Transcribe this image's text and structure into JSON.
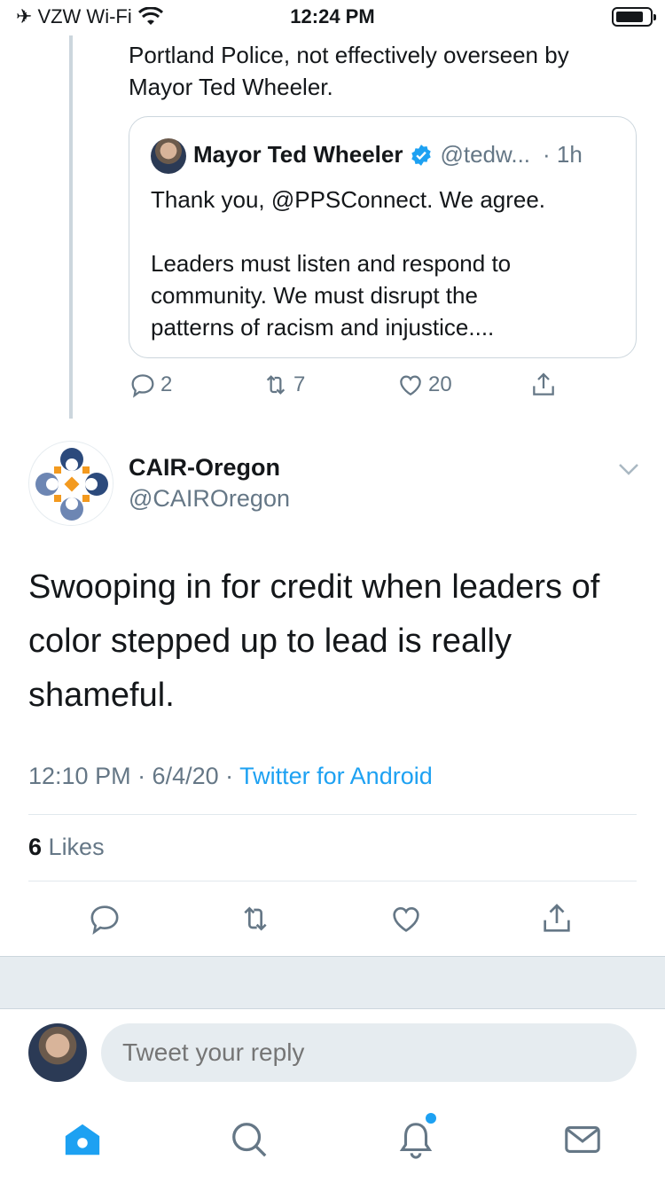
{
  "status_bar": {
    "carrier": "VZW Wi-Fi",
    "time": "12:24 PM"
  },
  "parent_tweet": {
    "text_line1": "Portland Police, not effectively overseen by",
    "text_line2": "Mayor Ted Wheeler.",
    "quoted": {
      "name": "Mayor Ted Wheeler",
      "handle": "@tedw...",
      "age": "· 1h",
      "line1": "Thank you, @PPSConnect. We agree.",
      "line2": "Leaders must listen and respond to",
      "line3": "community. We must disrupt the",
      "line4": "patterns of racism and injustice...."
    },
    "reply_count": "2",
    "retweet_count": "7",
    "like_count": "20"
  },
  "main_tweet": {
    "author_name": "CAIR-Oregon",
    "author_handle": "@CAIROregon",
    "text_line1": "Swooping in for credit when leaders of",
    "text_line2": "color stepped up to lead is really",
    "text_line3": "shameful.",
    "time": "12:10 PM · 6/4/20 · ",
    "source": "Twitter for Android",
    "likes_count": "6",
    "likes_label": "Likes"
  },
  "reply": {
    "placeholder": "Tweet your reply"
  },
  "tabs": [
    "home-icon",
    "search-icon",
    "notifications-icon",
    "messages-icon"
  ],
  "colors": {
    "accent": "#1da1f2",
    "secondary_text": "#657786",
    "divider": "#e1e8ed"
  }
}
